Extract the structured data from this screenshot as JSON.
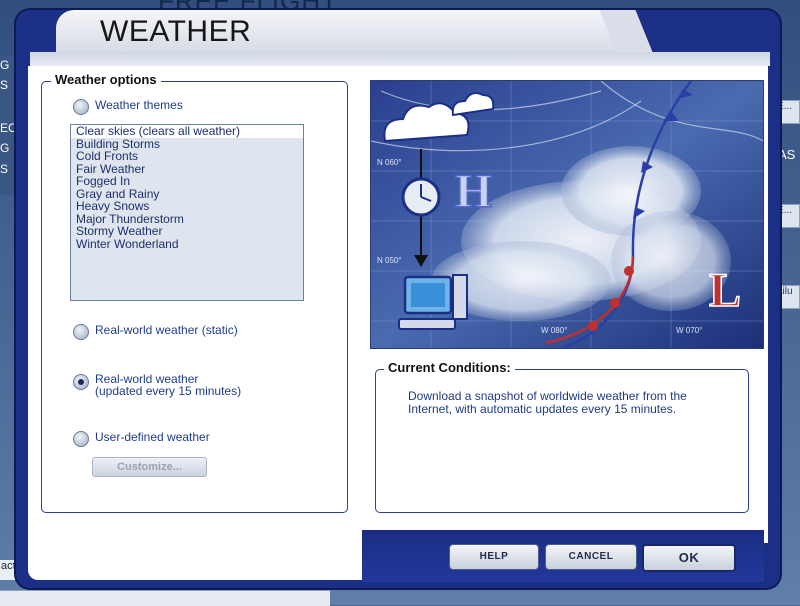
{
  "background": {
    "app_title": "FREE FLIGHT",
    "left_tags": [
      "G",
      "S",
      "EC",
      "G",
      "S"
    ],
    "right_tags": [
      "E...",
      "AS",
      "E...",
      "ailu"
    ],
    "bottom_left_text": "acts"
  },
  "dialog": {
    "title": "WEATHER",
    "weather_options": {
      "legend": "Weather options",
      "themes_radio": "Weather themes",
      "themes": [
        "Clear skies (clears all weather)",
        "Building Storms",
        "Cold Fronts",
        "Fair Weather",
        "Fogged In",
        "Gray and Rainy",
        "Heavy Snows",
        "Major Thunderstorm",
        "Stormy Weather",
        "Winter Wonderland"
      ],
      "selected_theme_index": 0,
      "realworld_static": "Real-world weather (static)",
      "realworld_updated_line1": "Real-world weather",
      "realworld_updated_line2": "(updated every 15 minutes)",
      "user_defined": "User-defined weather",
      "customize_button": "Customize...",
      "selected_option": "realworld_updated"
    },
    "illustration": {
      "high_label": "H",
      "low_label": "L",
      "grid_labels": [
        "N 060°",
        "N 050°",
        "W 070°",
        "W 080°"
      ]
    },
    "current_conditions": {
      "legend": "Current Conditions:",
      "text": "Download a snapshot of worldwide weather from the Internet, with automatic updates every 15 minutes."
    },
    "buttons": {
      "help": "HELP",
      "cancel": "CANCEL",
      "ok": "OK"
    }
  },
  "colors": {
    "frame_blue": "#1b2f86",
    "text_blue": "#1f3d8f",
    "low_red": "#c0302c",
    "high_blue": "#5466c8"
  }
}
